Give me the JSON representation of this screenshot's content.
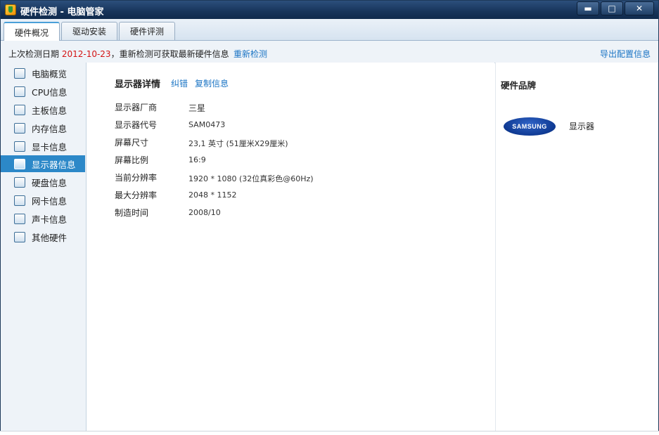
{
  "window": {
    "title": "硬件检测 - 电脑管家",
    "minimize": "▬",
    "maximize": "□",
    "close": "✕"
  },
  "tabs": [
    {
      "label": "硬件概况",
      "active": true
    },
    {
      "label": "驱动安装",
      "active": false
    },
    {
      "label": "硬件评测",
      "active": false
    }
  ],
  "infobar": {
    "prefix": "上次检测日期 ",
    "date": "2012-10-23",
    "suffix": "，重新检测可获取最新硬件信息",
    "recheck": "重新检测",
    "export": "导出配置信息"
  },
  "sidebar": {
    "items": [
      {
        "label": "电脑概览",
        "icon": "clipboard-icon"
      },
      {
        "label": "CPU信息",
        "icon": "cpu-icon"
      },
      {
        "label": "主板信息",
        "icon": "motherboard-icon"
      },
      {
        "label": "内存信息",
        "icon": "memory-icon"
      },
      {
        "label": "显卡信息",
        "icon": "graphics-card-icon"
      },
      {
        "label": "显示器信息",
        "icon": "monitor-icon",
        "active": true
      },
      {
        "label": "硬盘信息",
        "icon": "hard-disk-icon"
      },
      {
        "label": "网卡信息",
        "icon": "network-card-icon"
      },
      {
        "label": "声卡信息",
        "icon": "sound-card-icon"
      },
      {
        "label": "其他硬件",
        "icon": "other-hardware-icon"
      }
    ]
  },
  "details": {
    "title": "显示器详情",
    "correct": "纠错",
    "copy": "复制信息",
    "rows": [
      {
        "label": "显示器厂商",
        "value": "三星"
      },
      {
        "label": "显示器代号",
        "value": "SAM0473"
      },
      {
        "label": "屏幕尺寸",
        "value": "23,1 英寸 (51厘米X29厘米)"
      },
      {
        "label": "屏幕比例",
        "value": "16:9"
      },
      {
        "label": "当前分辨率",
        "value": "1920 * 1080 (32位真彩色@60Hz)"
      },
      {
        "label": "最大分辨率",
        "value": "2048 * 1152"
      },
      {
        "label": "制造时间",
        "value": "2008/10"
      }
    ]
  },
  "brand": {
    "title": "硬件品牌",
    "logo_text": "SAMSUNG",
    "category": "显示器"
  },
  "colors": {
    "accent": "#2c88c8",
    "link": "#1a74c4",
    "date": "#d41414"
  }
}
